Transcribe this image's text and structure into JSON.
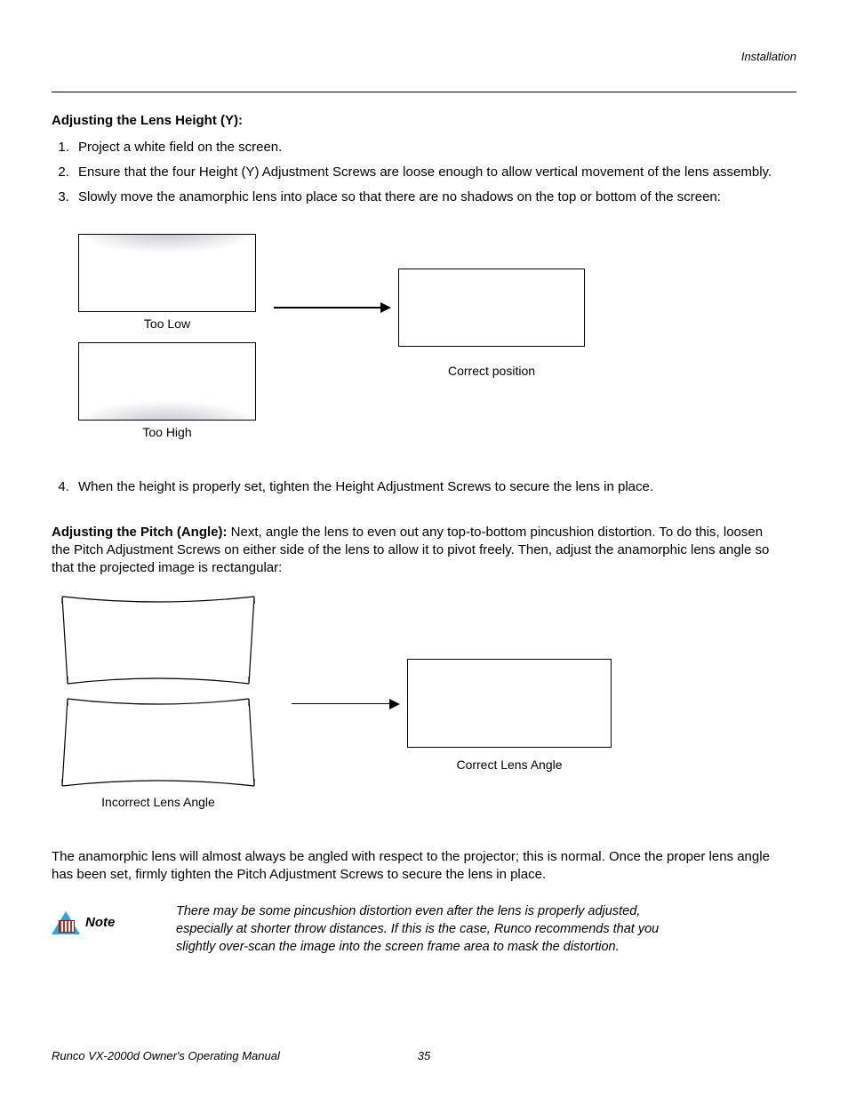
{
  "header": {
    "chapter": "Installation"
  },
  "section1": {
    "title": "Adjusting the Lens Height (Y):",
    "steps": [
      "Project a white field on the screen.",
      "Ensure that the four Height (Y) Adjustment Screws are loose enough to allow vertical movement of the lens assembly.",
      "Slowly move the anamorphic lens into place so that there are no shadows on the top or bottom of the screen:",
      "When the height is properly set, tighten the Height Adjustment Screws to secure the lens in place."
    ],
    "labels": {
      "too_low": "Too Low",
      "too_high": "Too High",
      "correct": "Correct position"
    }
  },
  "section2": {
    "title": "Adjusting the Pitch (Angle): ",
    "body": "Next, angle the lens to even out any top-to-bottom pincushion distortion. To do this, loosen the Pitch Adjustment Screws on either side of the lens to allow it to pivot freely. Then, adjust the anamorphic lens angle so that the projected image is rectangular:",
    "labels": {
      "incorrect": "Incorrect Lens Angle",
      "correct": "Correct Lens Angle"
    },
    "after": "The anamorphic lens will almost always be angled with respect to the projector; this is normal. Once the proper lens angle has been set, firmly tighten the Pitch Adjustment Screws to secure the lens in place."
  },
  "note": {
    "label": "Note",
    "text": "There may be some pincushion distortion even after the lens is properly adjusted, especially at shorter throw distances. If this is the case, Runco recommends that you slightly over-scan the image into the screen frame area to mask the distortion."
  },
  "footer": {
    "manual": "Runco VX-2000d Owner's Operating Manual",
    "page": "35"
  }
}
